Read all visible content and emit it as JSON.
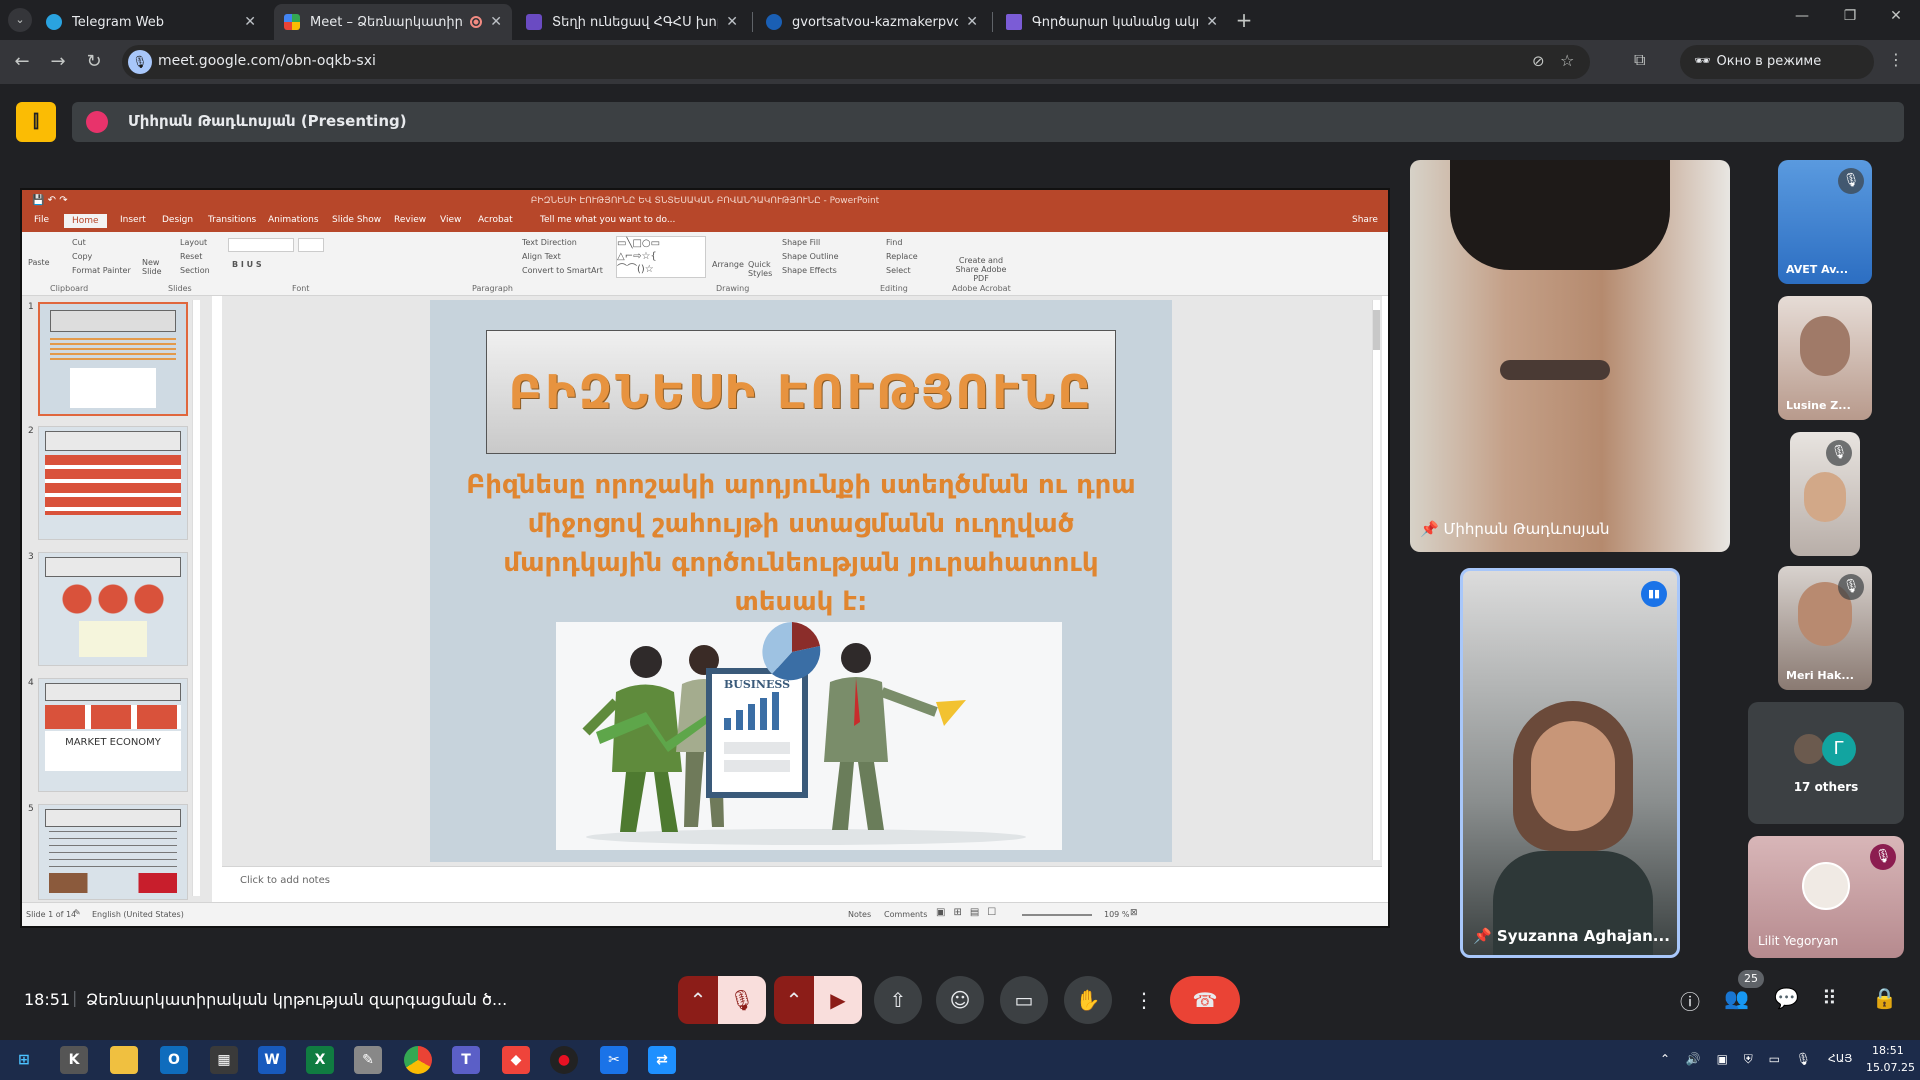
{
  "browser": {
    "tabs": [
      {
        "title": "Telegram Web",
        "color": "#2aa3e0",
        "active": false
      },
      {
        "title": "Meet – Ձեռնարկատիրակ",
        "color": "#34a853",
        "active": true
      },
      {
        "title": "Տեղի ունեցավ ՀԳՀՍ խորհրդ",
        "color": "#6a4bc2",
        "active": false
      },
      {
        "title": "gvortsatvou-kazmakerpvouthy",
        "color": "#1a5fb4",
        "active": false
      },
      {
        "title": "Գործարար կանանց ակումբ",
        "color": "#7b5cd6",
        "active": false
      }
    ],
    "url": "meet.google.com/obn-oqkb-sxi",
    "incognito_label": "Окно в режиме инкогнито"
  },
  "meet": {
    "presenting_label": "Միհրան Թադևոսյան (Presenting)",
    "time": "18:51",
    "meeting_title": "Ձեռնարկատիրական կրթության զարգացման ծ...",
    "participant_count": "25",
    "participants": {
      "main": "Միհրան Թադևոսյան",
      "second": "Syuzanna Aghajan...",
      "side": [
        "AVET Av...",
        "Lusine Z...",
        "",
        "Meri Hak..."
      ],
      "others_label": "17 others",
      "others_avatar_letter": "Г",
      "last": "Lilit Yegoryan"
    }
  },
  "ppt": {
    "title": "ԲԻԶՆԵՍԻ ԷՈՒԹՅՈՒՆԸ ԵՎ ՏՆՏԵՍԱԿԱՆ ԲՈՎԱՆԴԱԿՈՒԹՅՈՒՆԸ - PowerPoint",
    "tabs": [
      "File",
      "Home",
      "Insert",
      "Design",
      "Transitions",
      "Animations",
      "Slide Show",
      "Review",
      "View",
      "Acrobat",
      "Tell me what you want to do..."
    ],
    "share": "Share",
    "groups": [
      "Clipboard",
      "Slides",
      "Font",
      "Paragraph",
      "Drawing",
      "Editing",
      "Adobe Acrobat"
    ],
    "ribbon_items": {
      "paste": "Paste",
      "cut": "Cut",
      "copy": "Copy",
      "format_painter": "Format Painter",
      "new_slide": "New Slide",
      "layout": "Layout",
      "reset": "Reset",
      "section": "Section",
      "text_direction": "Text Direction",
      "align_text": "Align Text",
      "smartart": "Convert to SmartArt",
      "arrange": "Arrange",
      "quick_styles": "Quick Styles",
      "shape_fill": "Shape Fill",
      "shape_outline": "Shape Outline",
      "shape_effects": "Shape Effects",
      "find": "Find",
      "replace": "Replace",
      "select": "Select",
      "acrobat": "Create and Share Adobe PDF"
    },
    "slide_title": "ԲԻԶՆԵՍԻ ԷՈՒԹՅՈՒՆԸ",
    "slide_body": "Բիզնեսը որոշակի արդյունքի ստեղծման ու դրա միջոցով շահույթի ստացմանն ուղղված մարդկային գործունեության յուրահատուկ տեսակ է:",
    "slide_image_label": "BUSINESS",
    "notes_placeholder": "Click to add notes",
    "status": {
      "slide": "Slide 1 of 14",
      "language": "English (United States)",
      "notes": "Notes",
      "comments": "Comments",
      "zoom": "109 %"
    },
    "thumb_numbers": [
      "1",
      "2",
      "3",
      "4",
      "5"
    ],
    "thumb_4_label": "MARKET ECONOMY"
  },
  "taskbar": {
    "lang": "ՀԱՅ",
    "time": "18:51",
    "date": "15.07.25"
  }
}
